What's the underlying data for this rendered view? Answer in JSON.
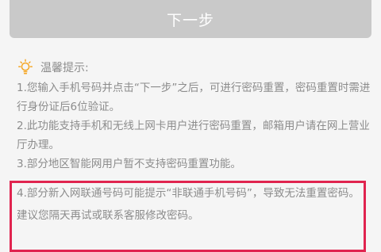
{
  "next_button": {
    "label": "下一步"
  },
  "tips": {
    "title": "温馨提示:",
    "items": [
      "1.您输入手机号码并点击“下一步”之后，可进行密码重置，密码重置时需进行身份证后6位验证。",
      "2.此功能支持手机和无线上网卡用户进行密码重置，邮箱用户请在网上营业厅办理。",
      "3.部分地区智能网用户暂不支持密码重置功能。",
      "4.部分新入网联通号码可能提示“非联通手机号码”，导致无法重置密码。建议您隔天再试或联系客服修改密码。"
    ]
  },
  "colors": {
    "button_bg": "#c9c9c9",
    "tip_text": "#8c8c8c",
    "icon_orange": "#f5a623",
    "highlight_border": "#e0244f"
  }
}
